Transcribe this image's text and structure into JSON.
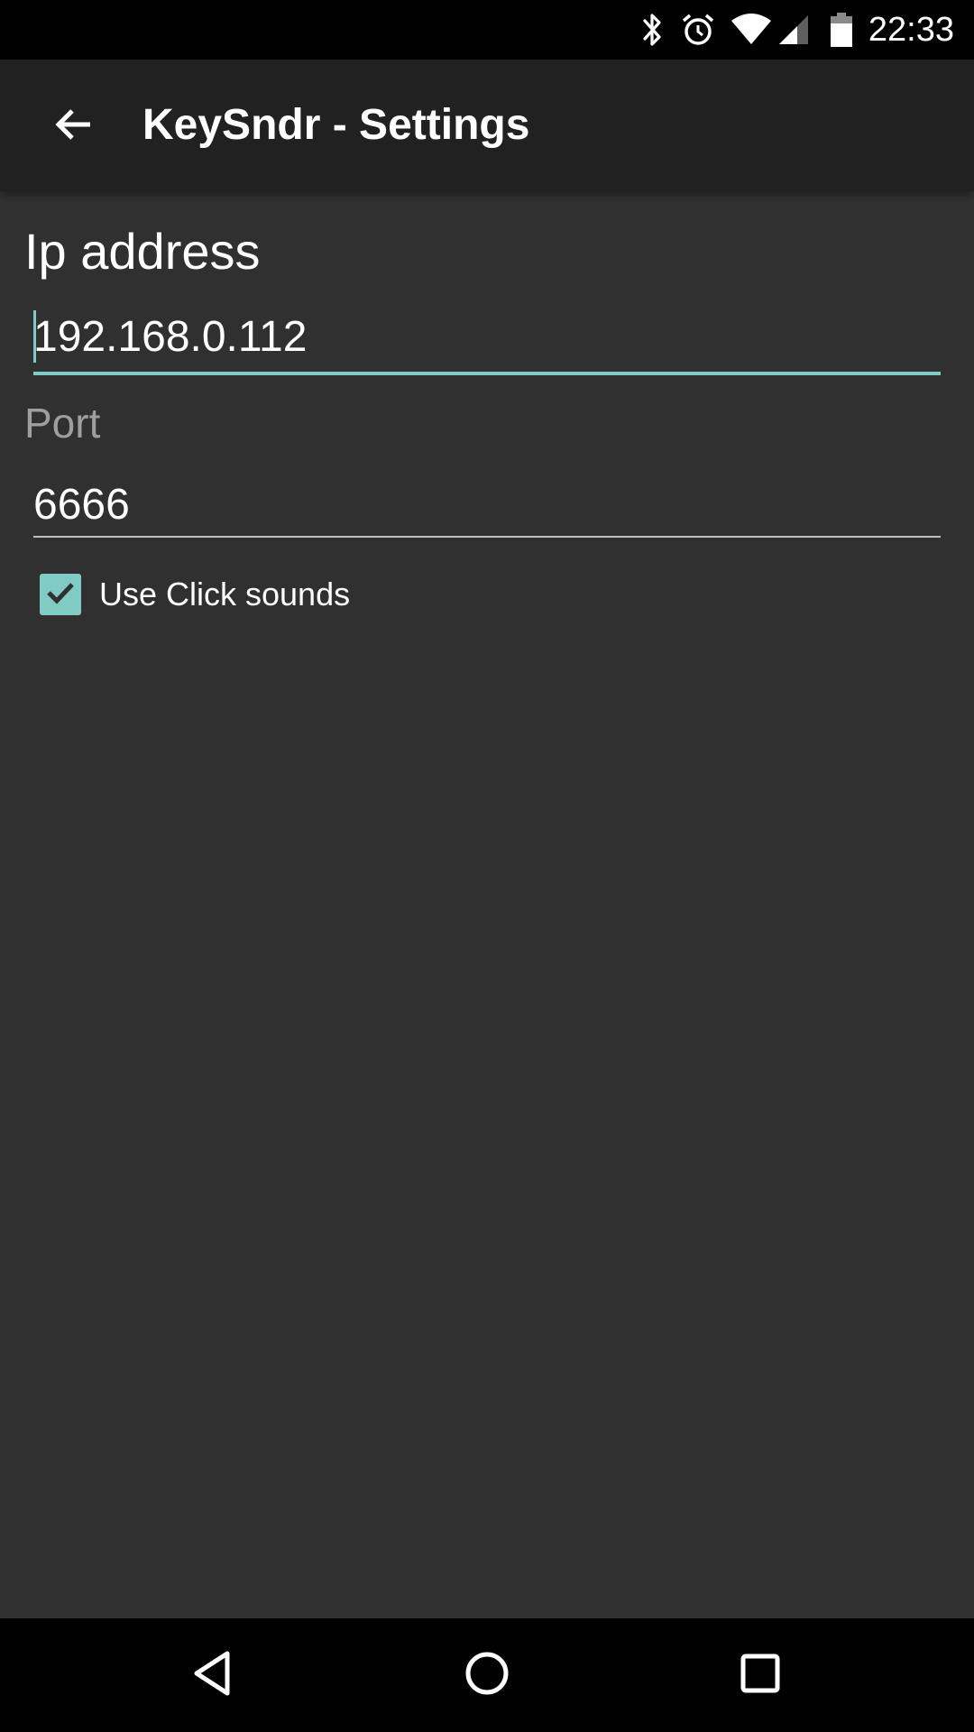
{
  "status_bar": {
    "time": "22:33",
    "icons": [
      "bluetooth-icon",
      "alarm-icon",
      "wifi-icon",
      "signal-icon",
      "battery-icon"
    ]
  },
  "app_bar": {
    "title": "KeySndr - Settings",
    "back_icon": "arrow-back-icon"
  },
  "settings": {
    "ip_label": "Ip address",
    "ip_value": "192.168.0.112",
    "port_label": "Port",
    "port_value": "6666",
    "click_sounds_label": "Use Click sounds",
    "click_sounds_checked": true
  },
  "nav_bar": {
    "icons": [
      "back-triangle-icon",
      "home-circle-icon",
      "recents-square-icon"
    ]
  },
  "colors": {
    "accent": "#80cbc4",
    "background": "#303030",
    "app_bar": "#212121"
  }
}
